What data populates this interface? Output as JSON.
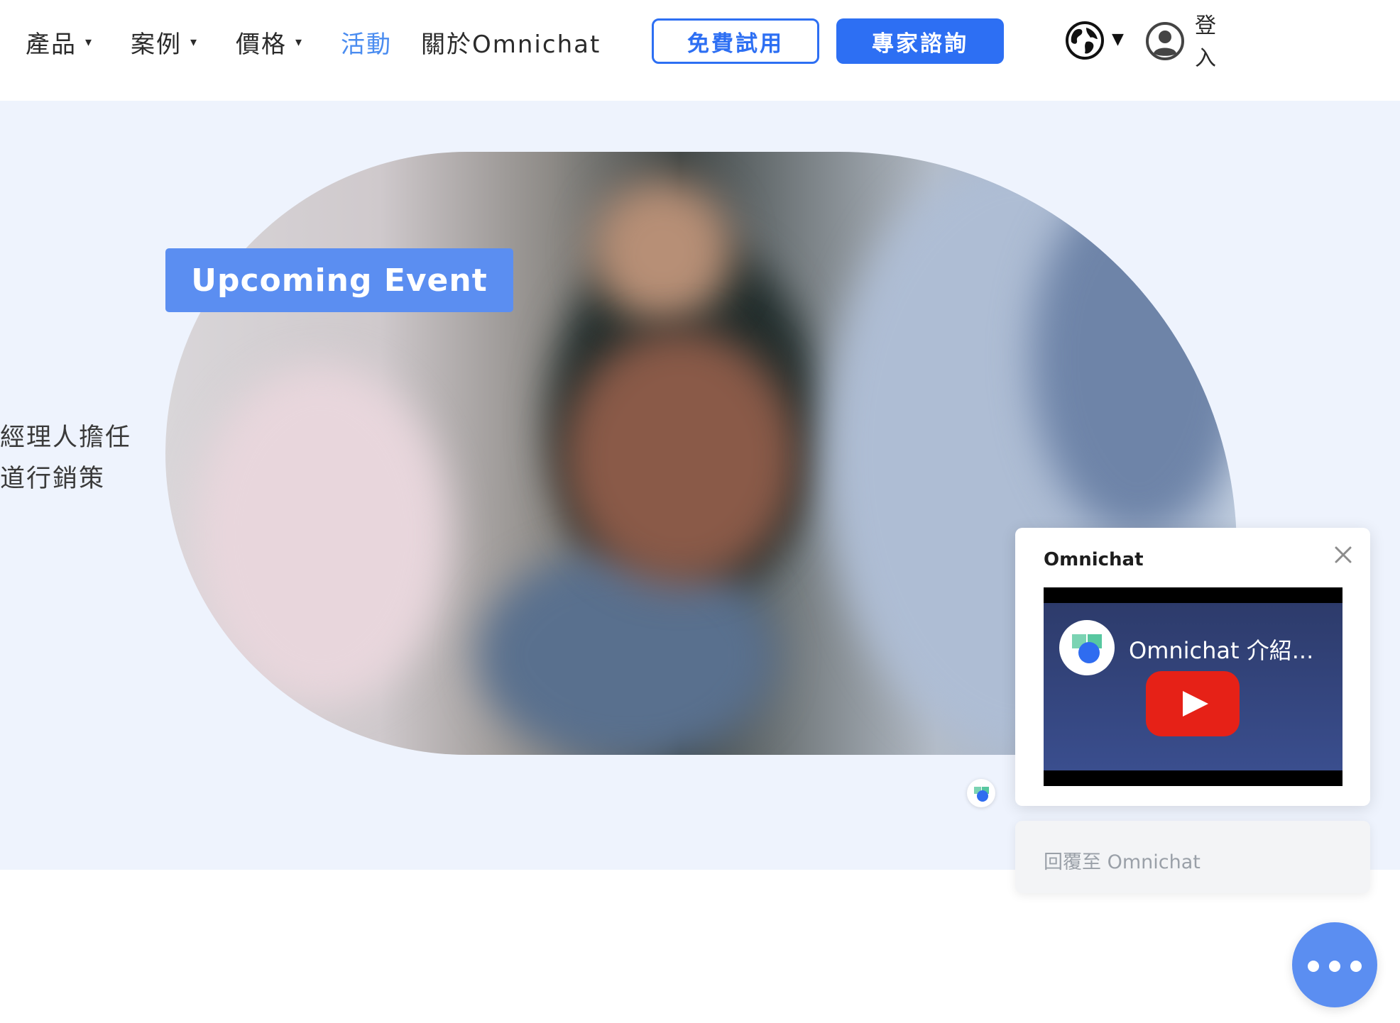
{
  "nav": {
    "items": [
      {
        "label": "產品",
        "has_caret": true
      },
      {
        "label": "案例",
        "has_caret": true
      },
      {
        "label": "價格",
        "has_caret": true
      },
      {
        "label": "活動",
        "has_caret": false,
        "active": true
      },
      {
        "label": "關於Omnichat",
        "has_caret": false
      }
    ],
    "trial_button": "免費試用",
    "consult_button": "專家諮詢",
    "login": "登入",
    "caret_glyph": "▾",
    "globe_caret": "▼"
  },
  "hero": {
    "text_lines": [
      "經理人擔任",
      "道行銷策"
    ],
    "badge": "Upcoming Event"
  },
  "chat": {
    "title": "Omnichat",
    "video_title": "Omnichat 介紹...",
    "reply_placeholder": "回覆至 Omnichat"
  },
  "colors": {
    "accent": "#2d6ff3",
    "active_nav": "#4a8cf0",
    "hero_bg": "#eef3fd",
    "badge_bg": "#5b8ef1",
    "fab_bg": "#5b8ef1",
    "youtube_red": "#e62117"
  },
  "icons": {
    "language": "globe-icon",
    "account": "user-avatar-icon",
    "close": "close-icon",
    "play": "youtube-play-icon",
    "chat_launcher": "more-dots-icon"
  }
}
